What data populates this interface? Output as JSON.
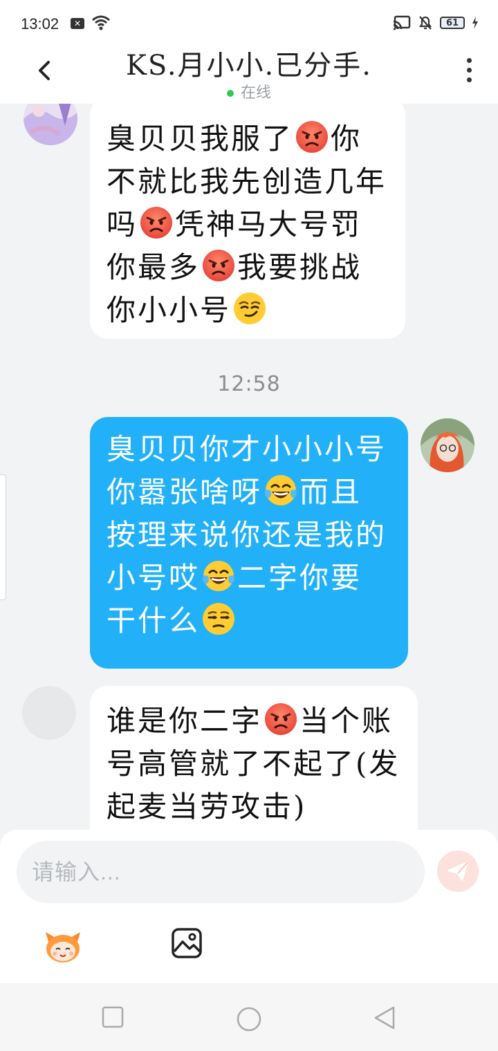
{
  "status_bar": {
    "time": "13:02",
    "battery": "61"
  },
  "header": {
    "title": "KS.月小小.已分手.",
    "presence": "在线"
  },
  "messages": [
    {
      "side": "incoming",
      "segments": [
        {
          "t": "text",
          "v": "臭贝贝我服了"
        },
        {
          "t": "emoji",
          "v": "angry-face"
        },
        {
          "t": "text",
          "v": "你不就比我先创造几年吗"
        },
        {
          "t": "emoji",
          "v": "angry-face"
        },
        {
          "t": "text",
          "v": "凭神马大号罚你最多"
        },
        {
          "t": "emoji",
          "v": "angry-face"
        },
        {
          "t": "text",
          "v": "我要挑战你小小号"
        },
        {
          "t": "emoji",
          "v": "smirk-face"
        }
      ]
    },
    {
      "side": "outgoing",
      "segments": [
        {
          "t": "text",
          "v": "臭贝贝你才小小小号你嚣张啥呀"
        },
        {
          "t": "emoji",
          "v": "tears-of-joy-face"
        },
        {
          "t": "text",
          "v": "而且按理来说你还是我的小号哎"
        },
        {
          "t": "emoji",
          "v": "tears-of-joy-face"
        },
        {
          "t": "text",
          "v": "二字你要干什么"
        },
        {
          "t": "emoji",
          "v": "unamused-face"
        }
      ]
    },
    {
      "side": "incoming",
      "segments": [
        {
          "t": "text",
          "v": "谁是你二字"
        },
        {
          "t": "emoji",
          "v": "angry-face"
        },
        {
          "t": "text",
          "v": "当个账号高管就了不起了(发起麦当劳攻击)"
        }
      ]
    }
  ],
  "timestamp": "12:58",
  "composer": {
    "placeholder": "请输入..."
  },
  "colors": {
    "outgoing_bubble": "#22b1f8",
    "incoming_bubble": "#ffffff",
    "background": "#f2f3f5",
    "send_button": "#fde1dc"
  }
}
